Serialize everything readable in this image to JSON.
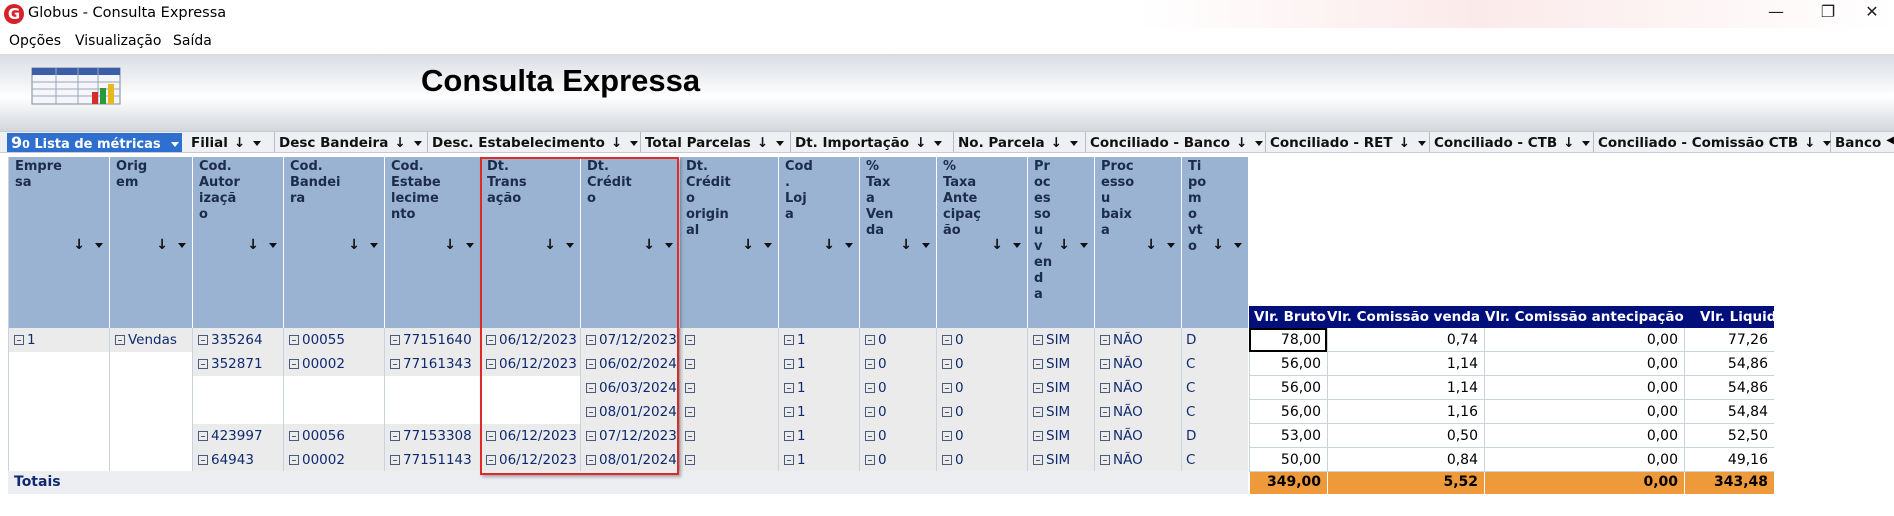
{
  "window": {
    "title": "Globus - Consulta Expressa",
    "icon_letter": "G",
    "minimize": "—",
    "restore": "❐",
    "close": "✕"
  },
  "menu": [
    "Opções",
    "Visualização",
    "Saída"
  ],
  "banner": {
    "title": "Consulta Expressa"
  },
  "ribbon": {
    "metricas_icon": "9",
    "metricas_suffix": "0",
    "metricas_label": "Lista de métricas",
    "tabs": [
      "Filial",
      "Desc Bandeira",
      "Desc. Estabelecimento",
      "Total Parcelas",
      "Dt. Importação",
      "No. Parcela",
      "Conciliado - Banco",
      "Conciliado - RET",
      "Conciliado - CTB",
      "Conciliado - Comissão CTB",
      "Banco"
    ]
  },
  "headers": [
    "Empre\nsa",
    "Orig\nem",
    "Cod.\nAutor\nizaçã\no",
    "Cod.\nBandei\nra",
    "Cod.\nEstabe\nlecime\nnto",
    "Dt.\nTrans\nação",
    "Dt.\nCrédit\no",
    "Dt.\nCrédit\no\norigin\nal",
    "Cod\n.\nLoj\na",
    "%\nTax\na\nVen\nda",
    "%\nTaxa\nAnte\ncipaç\não",
    "Pr\noc\nes\nso\nu\nv\nen\nd\na",
    "Proc\nesso\nu\nbaix\na",
    "Ti\npo\nm\no\nvt\no"
  ],
  "value_headers": [
    "Vlr. Bruto",
    "Vlr. Comissão venda",
    "Vlr. Comissão antecipação",
    "Vlr. Liquido"
  ],
  "rows": [
    {
      "empresa": "1",
      "origem": "Vendas",
      "autor": "335264",
      "bandeira": "00055",
      "estab": "77151640",
      "dt_trans": "06/12/2023",
      "dt_cred": "07/12/2023",
      "dt_orig": "",
      "loja": "1",
      "tx_venda": "0",
      "tx_ant": "0",
      "proc_venda": "SIM",
      "proc_baixa": "NÃO",
      "tipo": "D",
      "bruto": "78,00",
      "com_venda": "0,74",
      "com_ant": "0,00",
      "liquido": "77,26"
    },
    {
      "empresa": "",
      "origem": "",
      "autor": "352871",
      "bandeira": "00002",
      "estab": "77161343",
      "dt_trans": "06/12/2023",
      "dt_cred": "06/02/2024",
      "dt_orig": "",
      "loja": "1",
      "tx_venda": "0",
      "tx_ant": "0",
      "proc_venda": "SIM",
      "proc_baixa": "NÃO",
      "tipo": "C",
      "bruto": "56,00",
      "com_venda": "1,14",
      "com_ant": "0,00",
      "liquido": "54,86"
    },
    {
      "empresa": "",
      "origem": "",
      "autor": "",
      "bandeira": "",
      "estab": "",
      "dt_trans": "",
      "dt_cred": "06/03/2024",
      "dt_orig": "",
      "loja": "1",
      "tx_venda": "0",
      "tx_ant": "0",
      "proc_venda": "SIM",
      "proc_baixa": "NÃO",
      "tipo": "C",
      "bruto": "56,00",
      "com_venda": "1,14",
      "com_ant": "0,00",
      "liquido": "54,86"
    },
    {
      "empresa": "",
      "origem": "",
      "autor": "",
      "bandeira": "",
      "estab": "",
      "dt_trans": "",
      "dt_cred": "08/01/2024",
      "dt_orig": "",
      "loja": "1",
      "tx_venda": "0",
      "tx_ant": "0",
      "proc_venda": "SIM",
      "proc_baixa": "NÃO",
      "tipo": "C",
      "bruto": "56,00",
      "com_venda": "1,16",
      "com_ant": "0,00",
      "liquido": "54,84"
    },
    {
      "empresa": "",
      "origem": "",
      "autor": "423997",
      "bandeira": "00056",
      "estab": "77153308",
      "dt_trans": "06/12/2023",
      "dt_cred": "07/12/2023",
      "dt_orig": "",
      "loja": "1",
      "tx_venda": "0",
      "tx_ant": "0",
      "proc_venda": "SIM",
      "proc_baixa": "NÃO",
      "tipo": "D",
      "bruto": "53,00",
      "com_venda": "0,50",
      "com_ant": "0,00",
      "liquido": "52,50"
    },
    {
      "empresa": "",
      "origem": "",
      "autor": "64943",
      "bandeira": "00002",
      "estab": "77151143",
      "dt_trans": "06/12/2023",
      "dt_cred": "08/01/2024",
      "dt_orig": "",
      "loja": "1",
      "tx_venda": "0",
      "tx_ant": "0",
      "proc_venda": "SIM",
      "proc_baixa": "NÃO",
      "tipo": "C",
      "bruto": "50,00",
      "com_venda": "0,84",
      "com_ant": "0,00",
      "liquido": "49,16"
    }
  ],
  "totals": {
    "label": "Totais",
    "bruto": "349,00",
    "com_venda": "5,52",
    "com_ant": "0,00",
    "liquido": "343,48"
  },
  "colors": {
    "header_bg": "#9ab3d3",
    "value_header_bg": "#000f7a",
    "totals_bg": "#ee9a3a",
    "highlight": "#e02a2a",
    "metricas_bg": "#2f6fcf"
  }
}
